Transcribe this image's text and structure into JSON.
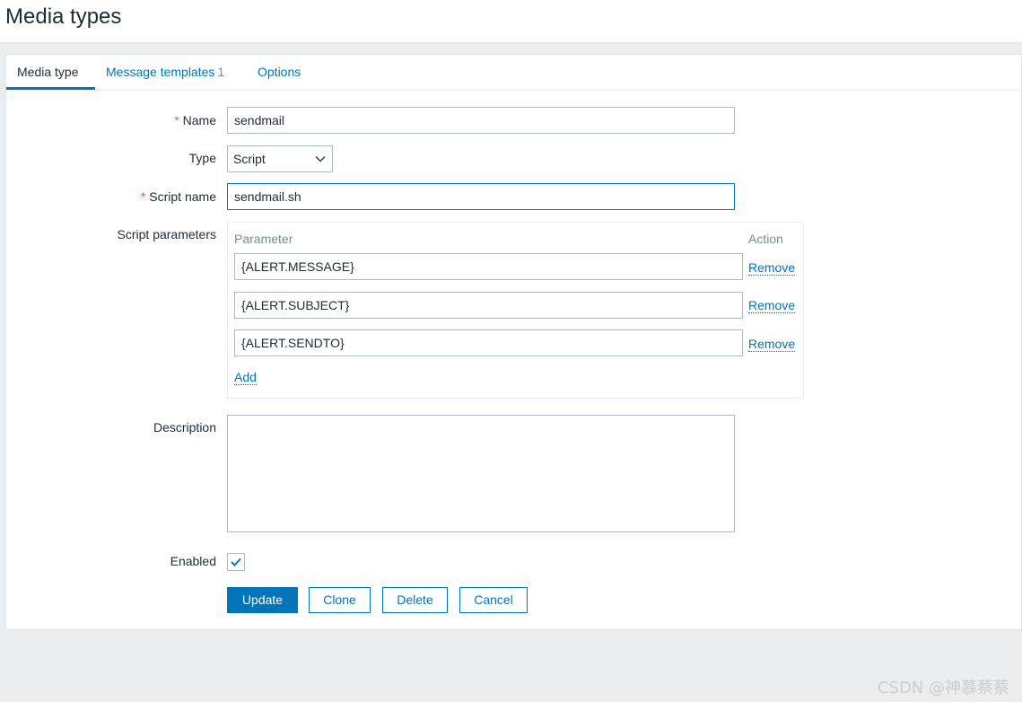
{
  "header": {
    "title": "Media types"
  },
  "tabs": [
    {
      "label": "Media type",
      "active": true
    },
    {
      "label": "Message templates",
      "count": "1"
    },
    {
      "label": "Options"
    }
  ],
  "form": {
    "name": {
      "label": "Name",
      "value": "sendmail",
      "required": true
    },
    "type": {
      "label": "Type",
      "value": "Script"
    },
    "script_name": {
      "label": "Script name",
      "value": "sendmail.sh",
      "required": true
    },
    "script_parameters": {
      "label": "Script parameters",
      "col_parameter": "Parameter",
      "col_action": "Action",
      "rows": [
        {
          "value": "{ALERT.MESSAGE}",
          "action": "Remove"
        },
        {
          "value": "{ALERT.SUBJECT}",
          "action": "Remove"
        },
        {
          "value": "{ALERT.SENDTO}",
          "action": "Remove"
        }
      ],
      "add_label": "Add"
    },
    "description": {
      "label": "Description",
      "value": ""
    },
    "enabled": {
      "label": "Enabled",
      "checked": true
    }
  },
  "buttons": {
    "update": "Update",
    "clone": "Clone",
    "delete": "Delete",
    "cancel": "Cancel"
  },
  "watermark": "CSDN @神慕蔡蔡",
  "colors": {
    "accent": "#0275b8",
    "required": "#e45959",
    "background": "#ebeef0"
  }
}
